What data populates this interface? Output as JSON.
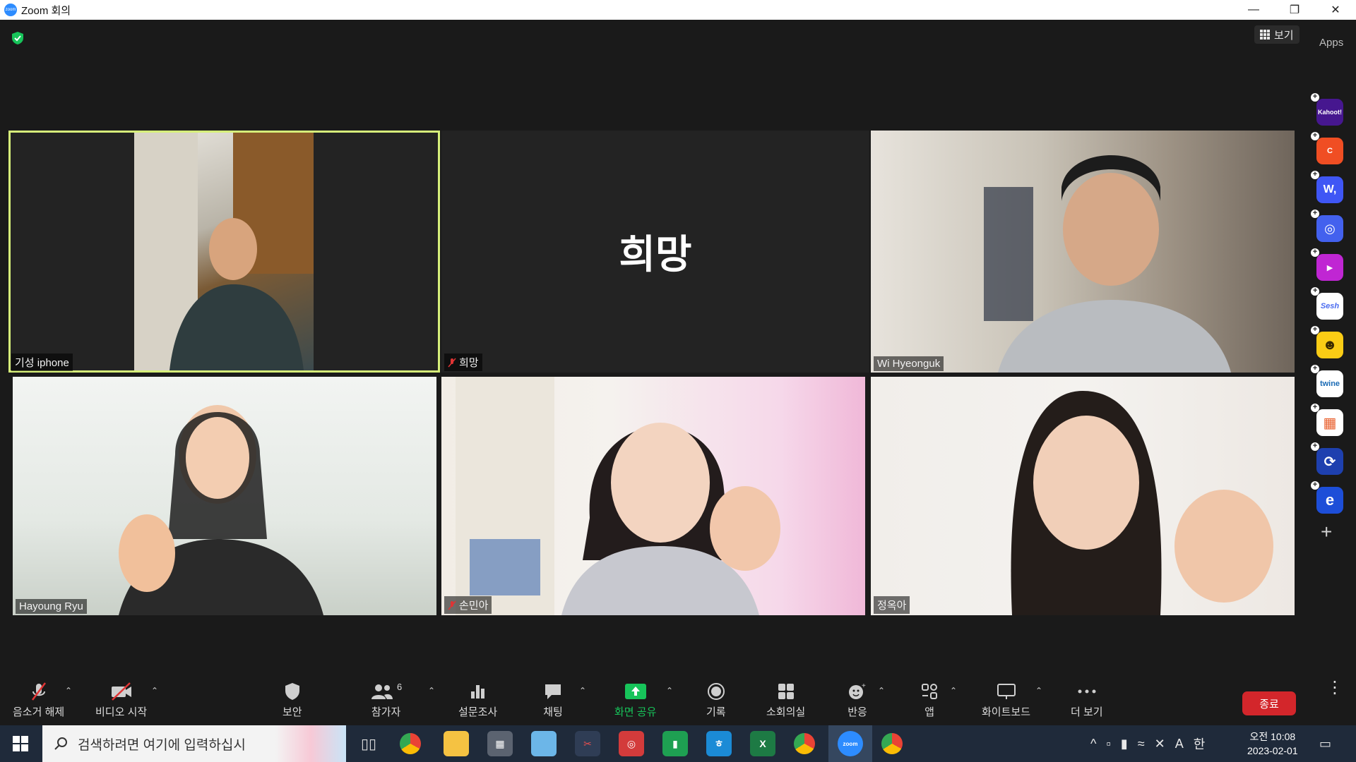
{
  "window": {
    "title": "Zoom 회의",
    "minimize": "—",
    "restore": "❐",
    "close": "✕"
  },
  "header": {
    "view_label": "보기",
    "apps_label": "Apps"
  },
  "participants": [
    {
      "name": "기성 iphone",
      "muted": false,
      "active": true
    },
    {
      "name": "희망",
      "muted": true,
      "display_name_large": "희망"
    },
    {
      "name": "Wi Hyeonguk",
      "muted": false
    },
    {
      "name": "Hayoung Ryu",
      "muted": false
    },
    {
      "name": "손민아",
      "muted": true
    },
    {
      "name": "정옥아",
      "muted": false
    }
  ],
  "sidebar_apps": [
    {
      "name": "Kahoot!",
      "label": "Kahoot!",
      "color": "#46178f"
    },
    {
      "name": "C-app",
      "label": "C",
      "color": "#f04e23"
    },
    {
      "name": "Wooclap",
      "label": "W,",
      "color": "#3f56f5"
    },
    {
      "name": "Circle-app",
      "label": "◎",
      "color": "#4361ee"
    },
    {
      "name": "Video-app",
      "label": "▶",
      "color": "#c026d3"
    },
    {
      "name": "Sesh",
      "label": "Sesh",
      "color": "#ffffff"
    },
    {
      "name": "Smile-app",
      "label": "☻",
      "color": "#facc15"
    },
    {
      "name": "twine",
      "label": "twine",
      "color": "#ffffff"
    },
    {
      "name": "Grid-app",
      "label": "▦",
      "color": "#ffffff"
    },
    {
      "name": "Sync-app",
      "label": "⟳",
      "color": "#1e40af"
    },
    {
      "name": "E-app",
      "label": "e",
      "color": "#1d4ed8"
    }
  ],
  "toolbar": {
    "unmute": "음소거 해제",
    "start_video": "비디오 시작",
    "security": "보안",
    "participants": "참가자",
    "participants_count": "6",
    "polls": "설문조사",
    "chat": "채팅",
    "share_screen": "화면 공유",
    "record": "기록",
    "breakout": "소회의실",
    "reactions": "반응",
    "apps": "앱",
    "whiteboard": "화이트보드",
    "more": "더 보기",
    "end": "종료"
  },
  "taskbar": {
    "search_placeholder": "검색하려면 여기에 입력하십시",
    "time_period": "오전 10:08",
    "date": "2023-02-01",
    "ime_a": "A",
    "ime_han": "한"
  },
  "colors": {
    "active_speaker": "#d6ef7a",
    "share_green": "#17c45a",
    "end_red": "#d3262b",
    "muted_red": "#e03434"
  }
}
